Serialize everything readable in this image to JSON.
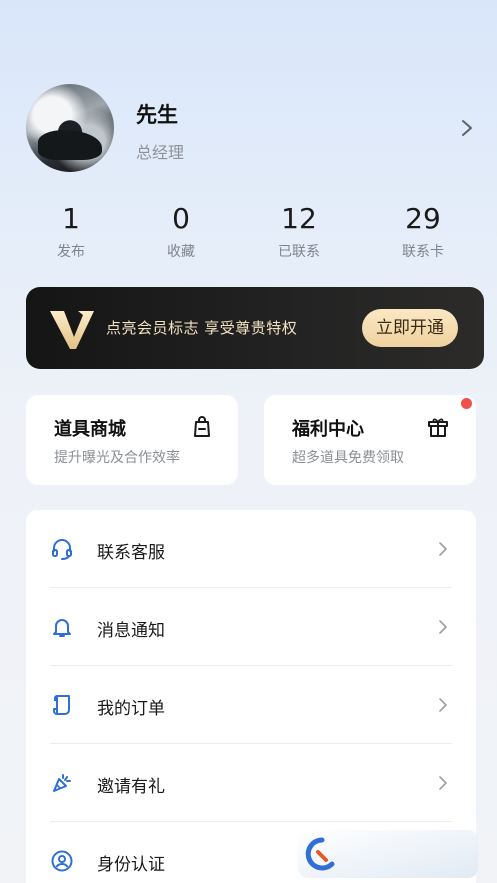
{
  "profile": {
    "name": "先生",
    "title": "总经理"
  },
  "stats": [
    {
      "value": "1",
      "label": "发布"
    },
    {
      "value": "0",
      "label": "收藏"
    },
    {
      "value": "12",
      "label": "已联系"
    },
    {
      "value": "29",
      "label": "联系卡"
    }
  ],
  "vip": {
    "text": "点亮会员标志 享受尊贵特权",
    "button": "立即开通"
  },
  "cards": {
    "shop": {
      "title": "道具商城",
      "subtitle": "提升曝光及合作效率",
      "icon": "shopping-bag-icon"
    },
    "welfare": {
      "title": "福利中心",
      "subtitle": "超多道具免费领取",
      "icon": "gift-box-icon"
    }
  },
  "menu": [
    {
      "label": "联系客服",
      "icon": "headset-icon"
    },
    {
      "label": "消息通知",
      "icon": "bell-icon"
    },
    {
      "label": "我的订单",
      "icon": "scroll-icon"
    },
    {
      "label": "邀请有礼",
      "icon": "party-popper-icon"
    },
    {
      "label": "身份认证",
      "icon": "user-circle-icon"
    }
  ],
  "colors": {
    "accent": "#2f6fd6",
    "vip_gold": "#f2e2c2",
    "badge": "#f0504a"
  }
}
